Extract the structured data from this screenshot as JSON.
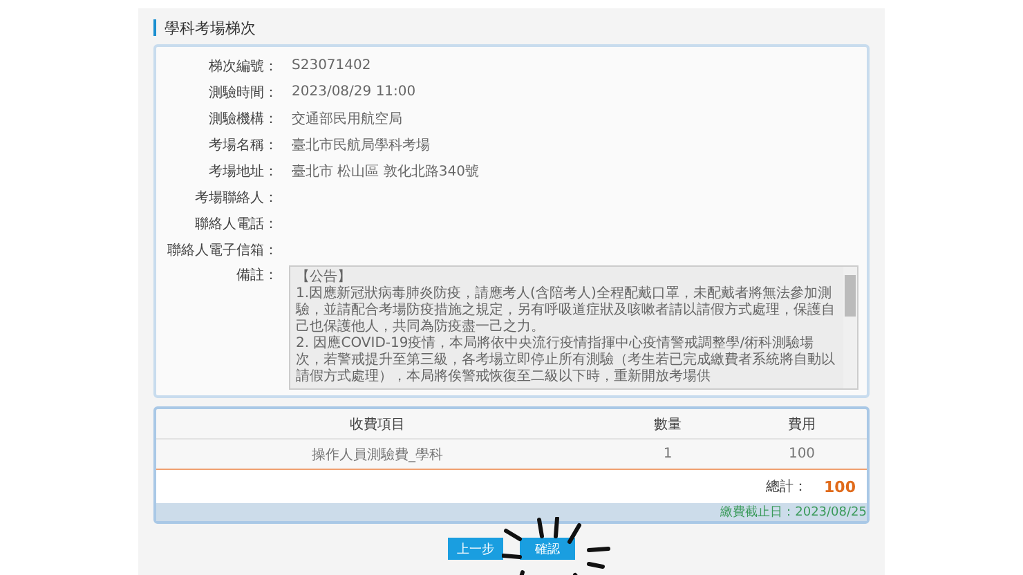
{
  "section_title": "學科考場梯次",
  "details": [
    {
      "label": "梯次編號：",
      "value": "S23071402"
    },
    {
      "label": "測驗時間：",
      "value": "2023/08/29 11:00"
    },
    {
      "label": "測驗機構：",
      "value": "交通部民用航空局"
    },
    {
      "label": "考場名稱：",
      "value": "臺北市民航局學科考場"
    },
    {
      "label": "考場地址：",
      "value": "臺北市 松山區 敦化北路340號"
    },
    {
      "label": "考場聯絡人："
    },
    {
      "label": "聯絡人電話："
    },
    {
      "label": "聯絡人電子信箱："
    }
  ],
  "notes": {
    "label": "備註：",
    "lines": [
      "【公告】",
      "1.因應新冠狀病毒肺炎防疫，請應考人(含陪考人)全程配戴口罩，未配戴者將無法參加測驗，並請配合考場防疫措施之規定，另有呼吸道症狀及咳嗽者請以請假方式處理，保護自己也保護他人，共同為防疫盡一己之力。",
      "2. 因應COVID-19疫情，本局將依中央流行疫情指揮中心疫情警戒調整學/術科測驗場次，若警戒提升至第三級，各考場立即停止所有測驗（考生若已完成繳費者系統將自動以請假方式處理），本局將俟警戒恢復至二級以下時，重新開放考場供"
    ]
  },
  "fees": {
    "columns": [
      "收費項目",
      "數量",
      "費用"
    ],
    "rows": [
      [
        "操作人員測驗費_學科",
        "1",
        "100"
      ]
    ],
    "total_label": "總計：",
    "total": "100",
    "deadline": "繳費截止日：2023/08/25"
  },
  "buttons": [
    "上一步",
    "確認"
  ]
}
